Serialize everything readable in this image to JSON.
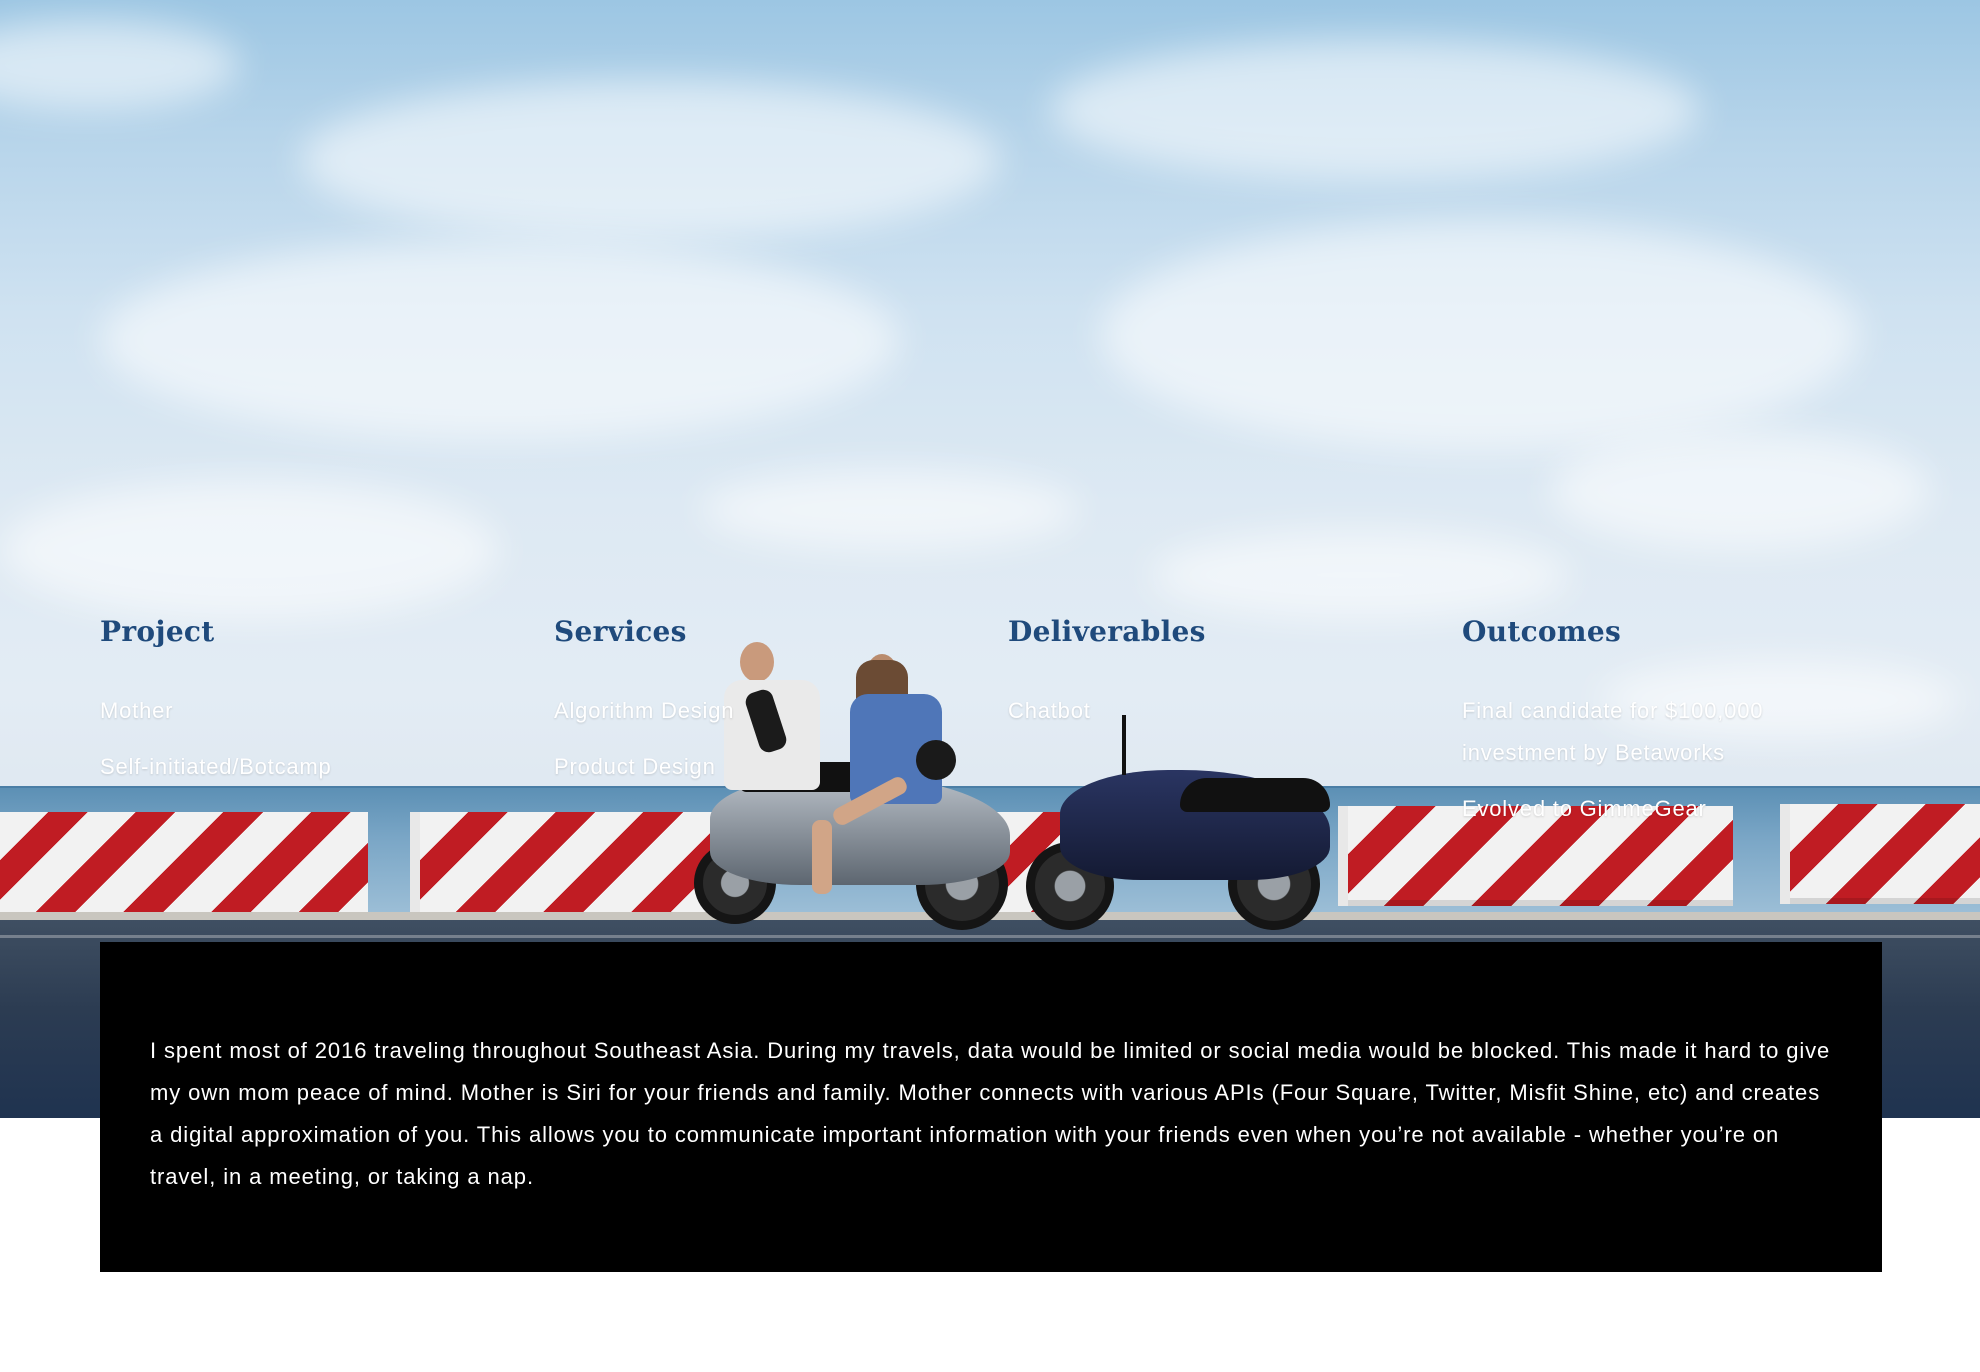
{
  "columns": [
    {
      "heading": "Project",
      "items": [
        "Mother",
        "Self-initiated/Botcamp"
      ]
    },
    {
      "heading": "Services",
      "items": [
        "Algorithm Design",
        "Product Design"
      ]
    },
    {
      "heading": "Deliverables",
      "items": [
        "Chatbot"
      ]
    },
    {
      "heading": "Outcomes",
      "items": [
        "Final candidate for $100,000 investment by Betaworks",
        "Evolved to GimmeGear"
      ]
    }
  ],
  "description": "I spent most of 2016 traveling throughout Southeast Asia. During my travels, data would be limited or social media would be blocked. This made it hard to give my own mom peace of mind. Mother is Siri for your friends and family. Mother connects with various APIs (Four Square, Twitter, Misfit Shine, etc) and creates a digital approximation of you. This allows you to communicate important information with your friends even when you’re not available - whether you’re on travel, in a meeting, or taking a nap.",
  "colors": {
    "heading": "#1f4a7c",
    "item_text": "#ffffff",
    "description_bg": "#000000",
    "description_text": "#ffffff",
    "barrier_red": "#c01c23",
    "barrier_white": "#f2f2f2"
  }
}
